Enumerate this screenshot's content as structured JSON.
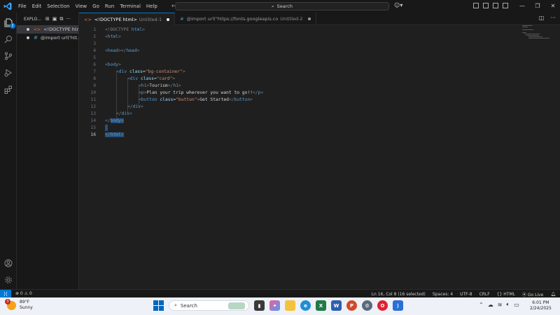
{
  "titlebar": {
    "menu": [
      "File",
      "Edit",
      "Selection",
      "View",
      "Go",
      "Run",
      "Terminal",
      "Help"
    ],
    "search_label": "Search"
  },
  "sidebar": {
    "header": "EXPLO...",
    "open_editors": [
      {
        "name": "<!DOCTYPE htm...",
        "icon": "html-file-icon"
      },
      {
        "name": "@import url('htt...",
        "icon": "css-file-icon"
      }
    ]
  },
  "activitybar": {
    "explorer_badge": "2"
  },
  "tabs": [
    {
      "label": "<!DOCTYPE html>",
      "sub": "Untitled-1",
      "active": true
    },
    {
      "label": "@import url(\"https://fonts.googleapis.co",
      "sub": "Untitled-2",
      "active": false
    }
  ],
  "editor": {
    "line_numbers": [
      "1",
      "2",
      "3",
      "4",
      "5",
      "6",
      "7",
      "8",
      "9",
      "10",
      "11",
      "12",
      "13",
      "14",
      "15",
      "16"
    ],
    "current_line": "16"
  },
  "code": {
    "l1": [
      "<!DOCTYPE ",
      "html",
      ">"
    ],
    "l2": [
      "<",
      "html",
      ">"
    ],
    "l4": [
      "<",
      "head",
      "></",
      "head",
      ">"
    ],
    "l6": [
      "<",
      "body",
      ">"
    ],
    "l7": [
      "<",
      "div",
      " ",
      "class",
      "=",
      "\"bg-container\"",
      ">"
    ],
    "l8": [
      "<",
      "div",
      " ",
      "class",
      "=",
      "\"card\"",
      ">"
    ],
    "l9": [
      "<",
      "h1",
      ">",
      "Tourism",
      "</",
      "h1",
      ">"
    ],
    "l10": [
      "<",
      "p",
      ">",
      "Plan your trip wherever you want to go!!",
      "</",
      "p",
      ">"
    ],
    "l11": [
      "<",
      "button",
      " ",
      "class",
      "=",
      "\"button\"",
      ">",
      "Get Started",
      "</",
      "button",
      ">"
    ],
    "l12": [
      "</",
      "div",
      ">"
    ],
    "l13": [
      "</",
      "div",
      ">"
    ],
    "l14": [
      "</",
      "body",
      ">"
    ],
    "l16": [
      "</",
      "html",
      ">"
    ]
  },
  "statusbar": {
    "problems": "⊗ 0 ⚠ 0",
    "position": "Ln 16, Col 8 (16 selected)",
    "spaces": "Spaces: 4",
    "encoding": "UTF-8",
    "eol": "CRLF",
    "language": "{} HTML",
    "golive": "Go Live"
  },
  "taskbar": {
    "weather_temp": "89°F",
    "weather_desc": "Sunny",
    "weather_badge": "3",
    "search_label": "Search",
    "time": "6:01 PM",
    "date": "2/24/2025"
  }
}
